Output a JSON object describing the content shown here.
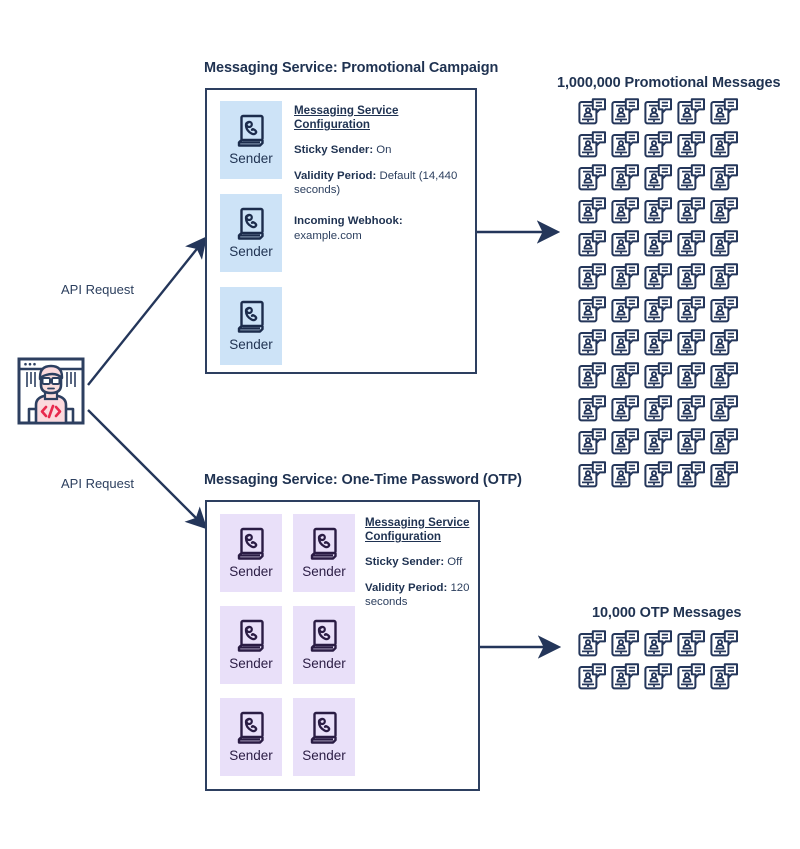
{
  "diagram": {
    "actor": {
      "name": "developer-icon",
      "description": "developer with glasses and code shirt"
    },
    "requests": [
      {
        "label": "API Request",
        "target": "promotional"
      },
      {
        "label": "API Request",
        "target": "otp"
      }
    ],
    "services": [
      {
        "id": "promotional",
        "title": "Messaging Service: Promotional Campaign",
        "sender_label": "Sender",
        "sender_count": 3,
        "accent_color": "#cde3f7",
        "config": {
          "heading": "Messaging Service Configuration",
          "rows": [
            {
              "key": "Sticky Sender:",
              "value": " On"
            },
            {
              "key": "Validity Period:",
              "value": " Default (14,440 seconds)"
            },
            {
              "key": "Incoming Webhook:",
              "value": " example.com"
            }
          ]
        },
        "output": {
          "title": "1,000,000 Promotional Messages",
          "icon": "phone-message-icon",
          "columns": 5,
          "rows": 12,
          "icon_count": 60
        }
      },
      {
        "id": "otp",
        "title": "Messaging Service: One-Time Password (OTP)",
        "sender_label": "Sender",
        "sender_count": 6,
        "accent_color": "#e9e0f9",
        "config": {
          "heading": "Messaging Service Configuration",
          "rows": [
            {
              "key": "Sticky Sender:",
              "value": " Off"
            },
            {
              "key": "Validity Period:",
              "value": " 120 seconds"
            }
          ]
        },
        "output": {
          "title": "10,000 OTP Messages",
          "icon": "phone-message-icon",
          "columns": 5,
          "rows": 2,
          "icon_count": 10
        }
      }
    ],
    "colors": {
      "ink": "#1f3251",
      "stroke": "#2d3f60",
      "promo_tile": "#cde3f7",
      "otp_tile": "#e9e0f9",
      "accent_red": "#e8294d",
      "skin": "#fadcdc",
      "shirt": "#fbd9dd"
    }
  }
}
